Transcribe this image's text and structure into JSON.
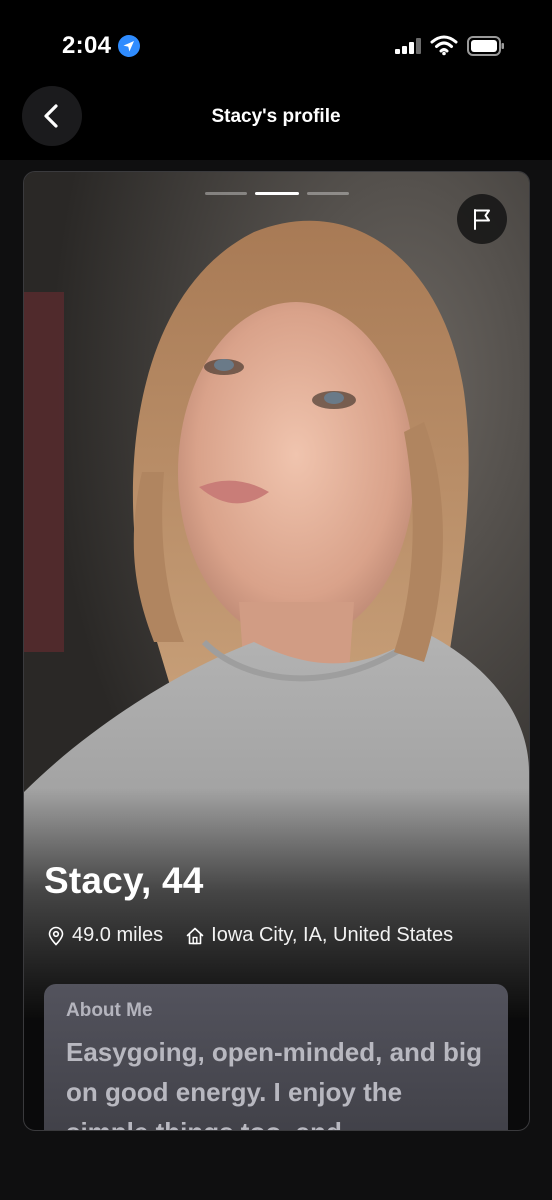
{
  "status_bar": {
    "time": "2:04",
    "icons": [
      "location-arrow-icon",
      "cellular-signal-icon",
      "wifi-icon",
      "battery-icon"
    ]
  },
  "nav": {
    "title": "Stacy's profile",
    "back_icon": "chevron-left-icon"
  },
  "profile": {
    "photo": "profile-photo",
    "photo_count": 3,
    "active_photo_index": 1,
    "report_icon": "flag-icon",
    "name_age": "Stacy, 44",
    "distance": "49.0 miles",
    "distance_icon": "location-pin-icon",
    "location": "Iowa City, IA, United States",
    "location_icon": "home-icon"
  },
  "about": {
    "label": "About Me",
    "text": "Easygoing, open-minded, and big on good energy. I enjoy the simple things too, and"
  },
  "colors": {
    "background": "#000000",
    "card_border": "#3a3a3d",
    "about_card": "#4a4a52",
    "text_primary": "#ffffff",
    "text_muted": "#b4b4bd",
    "location_arrow": "#2f8cff"
  }
}
